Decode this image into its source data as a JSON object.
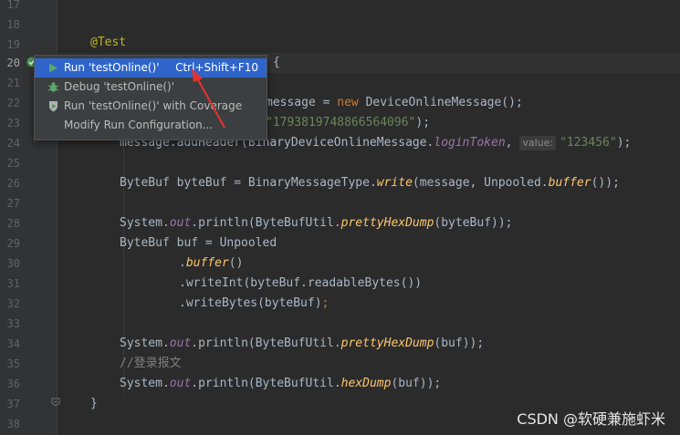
{
  "editor": {
    "line_numbers": [
      "17",
      "18",
      "19",
      "20",
      "21",
      "22",
      "23",
      "24",
      "25",
      "26",
      "27",
      "28",
      "29",
      "30",
      "31",
      "32",
      "33",
      "34",
      "35",
      "36",
      "37",
      "38"
    ],
    "annotation": "@Test",
    "line20_brace": "{",
    "line22_text": "message = new DeviceOnlineMessage();",
    "line22_prefix": "message = ",
    "line22_new": "new",
    "line22_rest": " DeviceOnlineMessage();",
    "line23_string": "\"1793819748866564096\"",
    "line23_close": ");",
    "line24_start": "message.addHeader(BinaryDeviceOnlineMessage.",
    "line24_field": "loginToken",
    "line24_comma": ", ",
    "line24_hint": "value:",
    "line24_string": "\"123456\"",
    "line24_end": ");",
    "line26_start": "ByteBuf byteBuf = BinaryMessageType.",
    "line26_method": "write",
    "line26_mid": "(message, Unpooled.",
    "line26_method2": "buffer",
    "line26_end": "());",
    "line28_start": "System.",
    "line28_out": "out",
    "line28_mid": ".println(ByteBufUtil.",
    "line28_method": "prettyHexDump",
    "line28_end": "(byteBuf));",
    "line29": "ByteBuf buf = Unpooled",
    "line30_dot": ".",
    "line30_method": "buffer",
    "line30_end": "()",
    "line31": ".writeInt(byteBuf.readableBytes())",
    "line32_start": ".writeBytes(byteBuf)",
    "line32_end": ";",
    "line34_start": "System.",
    "line34_out": "out",
    "line34_mid": ".println(ByteBufUtil.",
    "line34_method": "prettyHexDump",
    "line34_end": "(buf));",
    "line35_comment": "//登录报文",
    "line36_start": "System.",
    "line36_out": "out",
    "line36_mid": ".println(ByteBufUtil.",
    "line36_method": "hexDump",
    "line36_end": "(buf));",
    "line37": "}"
  },
  "context_menu": {
    "items": [
      {
        "label": "Run 'testOnline()'",
        "shortcut": "Ctrl+Shift+F10",
        "icon": "run-icon"
      },
      {
        "label": "Debug 'testOnline()'",
        "icon": "debug-icon"
      },
      {
        "label": "Run 'testOnline()' with Coverage",
        "icon": "coverage-icon"
      },
      {
        "label": "Modify Run Configuration...",
        "icon": ""
      }
    ]
  },
  "watermark": "CSDN @软硬兼施虾米",
  "colors": {
    "background": "#2b2b2b",
    "selection": "#2f65ca",
    "run_green": "#499c54",
    "arrow_red": "#e8322d"
  }
}
